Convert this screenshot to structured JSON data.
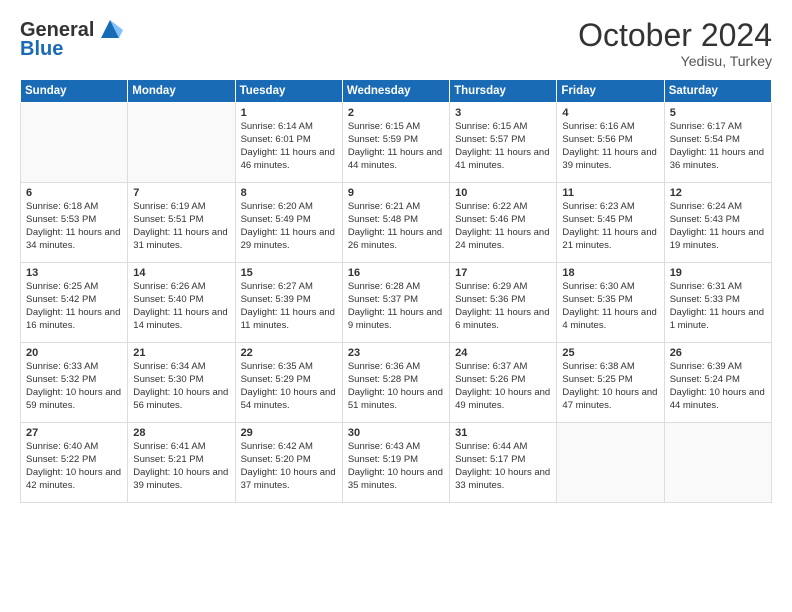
{
  "header": {
    "logo_line1": "General",
    "logo_line2": "Blue",
    "title": "October 2024",
    "subtitle": "Yedisu, Turkey"
  },
  "days_of_week": [
    "Sunday",
    "Monday",
    "Tuesday",
    "Wednesday",
    "Thursday",
    "Friday",
    "Saturday"
  ],
  "weeks": [
    [
      {
        "date": "",
        "sunrise": "",
        "sunset": "",
        "daylight": "",
        "empty": true
      },
      {
        "date": "",
        "sunrise": "",
        "sunset": "",
        "daylight": "",
        "empty": true
      },
      {
        "date": "1",
        "sunrise": "Sunrise: 6:14 AM",
        "sunset": "Sunset: 6:01 PM",
        "daylight": "Daylight: 11 hours and 46 minutes.",
        "empty": false
      },
      {
        "date": "2",
        "sunrise": "Sunrise: 6:15 AM",
        "sunset": "Sunset: 5:59 PM",
        "daylight": "Daylight: 11 hours and 44 minutes.",
        "empty": false
      },
      {
        "date": "3",
        "sunrise": "Sunrise: 6:15 AM",
        "sunset": "Sunset: 5:57 PM",
        "daylight": "Daylight: 11 hours and 41 minutes.",
        "empty": false
      },
      {
        "date": "4",
        "sunrise": "Sunrise: 6:16 AM",
        "sunset": "Sunset: 5:56 PM",
        "daylight": "Daylight: 11 hours and 39 minutes.",
        "empty": false
      },
      {
        "date": "5",
        "sunrise": "Sunrise: 6:17 AM",
        "sunset": "Sunset: 5:54 PM",
        "daylight": "Daylight: 11 hours and 36 minutes.",
        "empty": false
      }
    ],
    [
      {
        "date": "6",
        "sunrise": "Sunrise: 6:18 AM",
        "sunset": "Sunset: 5:53 PM",
        "daylight": "Daylight: 11 hours and 34 minutes.",
        "empty": false
      },
      {
        "date": "7",
        "sunrise": "Sunrise: 6:19 AM",
        "sunset": "Sunset: 5:51 PM",
        "daylight": "Daylight: 11 hours and 31 minutes.",
        "empty": false
      },
      {
        "date": "8",
        "sunrise": "Sunrise: 6:20 AM",
        "sunset": "Sunset: 5:49 PM",
        "daylight": "Daylight: 11 hours and 29 minutes.",
        "empty": false
      },
      {
        "date": "9",
        "sunrise": "Sunrise: 6:21 AM",
        "sunset": "Sunset: 5:48 PM",
        "daylight": "Daylight: 11 hours and 26 minutes.",
        "empty": false
      },
      {
        "date": "10",
        "sunrise": "Sunrise: 6:22 AM",
        "sunset": "Sunset: 5:46 PM",
        "daylight": "Daylight: 11 hours and 24 minutes.",
        "empty": false
      },
      {
        "date": "11",
        "sunrise": "Sunrise: 6:23 AM",
        "sunset": "Sunset: 5:45 PM",
        "daylight": "Daylight: 11 hours and 21 minutes.",
        "empty": false
      },
      {
        "date": "12",
        "sunrise": "Sunrise: 6:24 AM",
        "sunset": "Sunset: 5:43 PM",
        "daylight": "Daylight: 11 hours and 19 minutes.",
        "empty": false
      }
    ],
    [
      {
        "date": "13",
        "sunrise": "Sunrise: 6:25 AM",
        "sunset": "Sunset: 5:42 PM",
        "daylight": "Daylight: 11 hours and 16 minutes.",
        "empty": false
      },
      {
        "date": "14",
        "sunrise": "Sunrise: 6:26 AM",
        "sunset": "Sunset: 5:40 PM",
        "daylight": "Daylight: 11 hours and 14 minutes.",
        "empty": false
      },
      {
        "date": "15",
        "sunrise": "Sunrise: 6:27 AM",
        "sunset": "Sunset: 5:39 PM",
        "daylight": "Daylight: 11 hours and 11 minutes.",
        "empty": false
      },
      {
        "date": "16",
        "sunrise": "Sunrise: 6:28 AM",
        "sunset": "Sunset: 5:37 PM",
        "daylight": "Daylight: 11 hours and 9 minutes.",
        "empty": false
      },
      {
        "date": "17",
        "sunrise": "Sunrise: 6:29 AM",
        "sunset": "Sunset: 5:36 PM",
        "daylight": "Daylight: 11 hours and 6 minutes.",
        "empty": false
      },
      {
        "date": "18",
        "sunrise": "Sunrise: 6:30 AM",
        "sunset": "Sunset: 5:35 PM",
        "daylight": "Daylight: 11 hours and 4 minutes.",
        "empty": false
      },
      {
        "date": "19",
        "sunrise": "Sunrise: 6:31 AM",
        "sunset": "Sunset: 5:33 PM",
        "daylight": "Daylight: 11 hours and 1 minute.",
        "empty": false
      }
    ],
    [
      {
        "date": "20",
        "sunrise": "Sunrise: 6:33 AM",
        "sunset": "Sunset: 5:32 PM",
        "daylight": "Daylight: 10 hours and 59 minutes.",
        "empty": false
      },
      {
        "date": "21",
        "sunrise": "Sunrise: 6:34 AM",
        "sunset": "Sunset: 5:30 PM",
        "daylight": "Daylight: 10 hours and 56 minutes.",
        "empty": false
      },
      {
        "date": "22",
        "sunrise": "Sunrise: 6:35 AM",
        "sunset": "Sunset: 5:29 PM",
        "daylight": "Daylight: 10 hours and 54 minutes.",
        "empty": false
      },
      {
        "date": "23",
        "sunrise": "Sunrise: 6:36 AM",
        "sunset": "Sunset: 5:28 PM",
        "daylight": "Daylight: 10 hours and 51 minutes.",
        "empty": false
      },
      {
        "date": "24",
        "sunrise": "Sunrise: 6:37 AM",
        "sunset": "Sunset: 5:26 PM",
        "daylight": "Daylight: 10 hours and 49 minutes.",
        "empty": false
      },
      {
        "date": "25",
        "sunrise": "Sunrise: 6:38 AM",
        "sunset": "Sunset: 5:25 PM",
        "daylight": "Daylight: 10 hours and 47 minutes.",
        "empty": false
      },
      {
        "date": "26",
        "sunrise": "Sunrise: 6:39 AM",
        "sunset": "Sunset: 5:24 PM",
        "daylight": "Daylight: 10 hours and 44 minutes.",
        "empty": false
      }
    ],
    [
      {
        "date": "27",
        "sunrise": "Sunrise: 6:40 AM",
        "sunset": "Sunset: 5:22 PM",
        "daylight": "Daylight: 10 hours and 42 minutes.",
        "empty": false
      },
      {
        "date": "28",
        "sunrise": "Sunrise: 6:41 AM",
        "sunset": "Sunset: 5:21 PM",
        "daylight": "Daylight: 10 hours and 39 minutes.",
        "empty": false
      },
      {
        "date": "29",
        "sunrise": "Sunrise: 6:42 AM",
        "sunset": "Sunset: 5:20 PM",
        "daylight": "Daylight: 10 hours and 37 minutes.",
        "empty": false
      },
      {
        "date": "30",
        "sunrise": "Sunrise: 6:43 AM",
        "sunset": "Sunset: 5:19 PM",
        "daylight": "Daylight: 10 hours and 35 minutes.",
        "empty": false
      },
      {
        "date": "31",
        "sunrise": "Sunrise: 6:44 AM",
        "sunset": "Sunset: 5:17 PM",
        "daylight": "Daylight: 10 hours and 33 minutes.",
        "empty": false
      },
      {
        "date": "",
        "sunrise": "",
        "sunset": "",
        "daylight": "",
        "empty": true
      },
      {
        "date": "",
        "sunrise": "",
        "sunset": "",
        "daylight": "",
        "empty": true
      }
    ]
  ]
}
